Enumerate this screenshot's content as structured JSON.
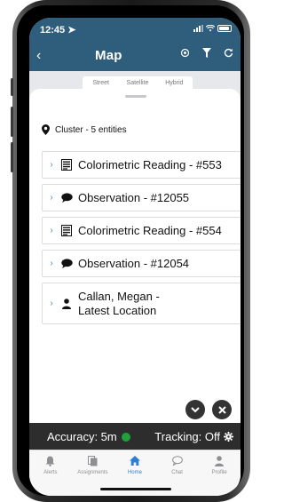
{
  "status": {
    "time": "12:45"
  },
  "nav": {
    "back": "‹",
    "title": "Map"
  },
  "layers": [
    "Street",
    "Satellite",
    "Hybrid"
  ],
  "cluster": {
    "label": "Cluster - 5 entities"
  },
  "entities": [
    {
      "label": "Colorimetric Reading - #553",
      "icon": "reading-icon"
    },
    {
      "label": "Observation - #12055",
      "icon": "chat-bubble-icon"
    },
    {
      "label": "Colorimetric Reading - #554",
      "icon": "reading-icon"
    },
    {
      "label": "Observation - #12054",
      "icon": "chat-bubble-icon"
    },
    {
      "label_line1": "Callan, Megan -",
      "label_line2": "Latest Location",
      "icon": "person-icon"
    }
  ],
  "accuracy": {
    "label": "Accuracy: 5m",
    "status_color": "#1fa03a"
  },
  "tracking": {
    "label": "Tracking: Off"
  },
  "tabs": [
    {
      "label": "Alerts",
      "icon": "bell-icon",
      "active": false
    },
    {
      "label": "Assignments",
      "icon": "assignments-icon",
      "active": false
    },
    {
      "label": "Home",
      "icon": "home-icon",
      "active": true
    },
    {
      "label": "Chat",
      "icon": "chat-icon",
      "active": false
    },
    {
      "label": "Profile",
      "icon": "profile-icon",
      "active": false
    }
  ],
  "colors": {
    "header": "#2f5d7c",
    "accent": "#2f7fd0",
    "footer_bar": "#2d2d2d"
  }
}
